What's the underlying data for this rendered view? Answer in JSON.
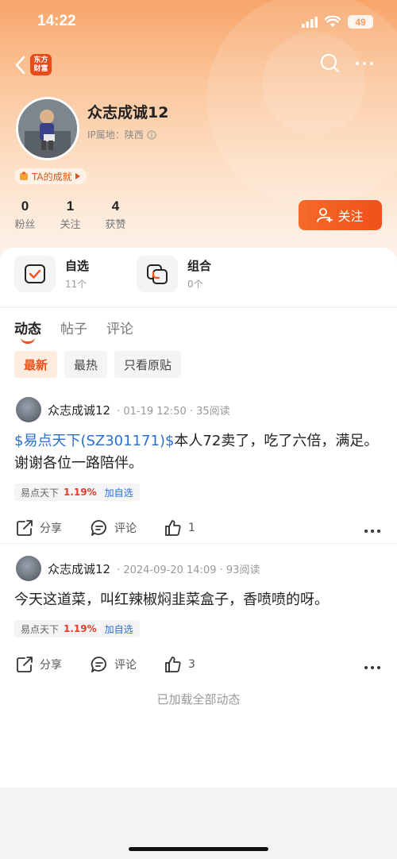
{
  "status_bar": {
    "time": "14:22",
    "battery": "49"
  },
  "nav": {
    "logo_line1": "东方",
    "logo_line2": "财富"
  },
  "profile": {
    "username": "众志成诚12",
    "ip_label": "IP属地：陕西",
    "achievement": "TA的成就",
    "stats": [
      {
        "num": "0",
        "label": "粉丝"
      },
      {
        "num": "1",
        "label": "关注"
      },
      {
        "num": "4",
        "label": "获赞"
      }
    ],
    "follow_label": "关注"
  },
  "quick": [
    {
      "title": "自选",
      "sub": "11个"
    },
    {
      "title": "组合",
      "sub": "0个"
    }
  ],
  "tabs": [
    "动态",
    "帖子",
    "评论"
  ],
  "filters": [
    "最新",
    "最热",
    "只看原贴"
  ],
  "posts": [
    {
      "name": "众志成诚12",
      "meta": "· 01-19 12:50 · 35阅读",
      "stock_link": "$易点天下(SZ301171)$",
      "text": "本人72卖了，吃了六倍，满足。谢谢各位一路陪伴。",
      "tag_name": "易点天下",
      "tag_pct": "1.19%",
      "tag_add": "加自选",
      "share": "分享",
      "comment": "评论",
      "likes": "1"
    },
    {
      "name": "众志成诚12",
      "meta": "· 2024-09-20 14:09 · 93阅读",
      "text": "今天这道菜，叫红辣椒焖韭菜盒子，香喷喷的呀。",
      "tag_name": "易点天下",
      "tag_pct": "1.19%",
      "tag_add": "加自选",
      "share": "分享",
      "comment": "评论",
      "likes": "3"
    }
  ],
  "footer_text": "已加载全部动态"
}
